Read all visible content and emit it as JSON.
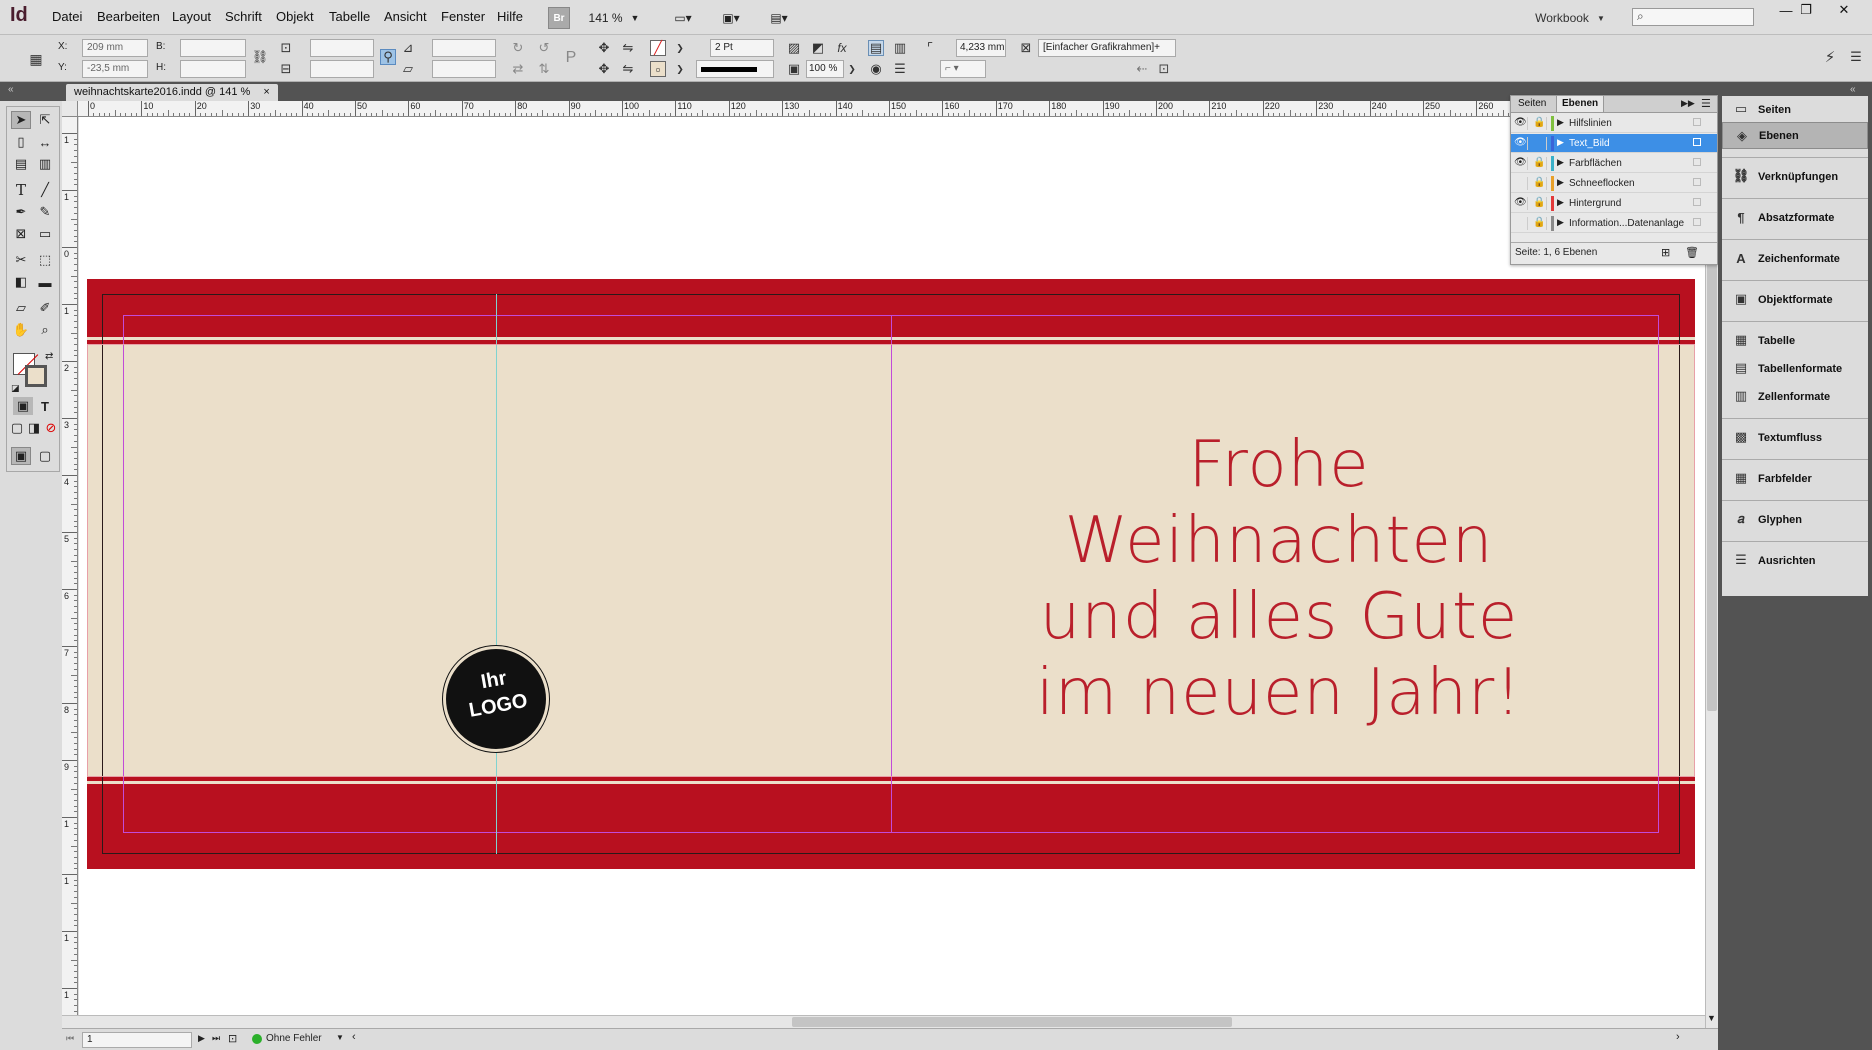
{
  "app": {
    "logo": "Id",
    "title": "InDesign"
  },
  "menu": [
    "Datei",
    "Bearbeiten",
    "Layout",
    "Schrift",
    "Objekt",
    "Tabelle",
    "Ansicht",
    "Fenster",
    "Hilfe"
  ],
  "menubar": {
    "bridge_label": "Br",
    "zoom": "141 %",
    "workspace": "Workbook",
    "search_placeholder": ""
  },
  "window_controls": {
    "minimize": "—",
    "restore": "❐",
    "close": "✕"
  },
  "control": {
    "x_label": "X:",
    "x_value": "209 mm",
    "y_label": "Y:",
    "y_value": "-23,5 mm",
    "w_label": "B:",
    "w_value": "",
    "h_label": "H:",
    "h_value": "",
    "stroke_weight": "2 Pt",
    "opacity": "100 %",
    "ref_value": "4,233 mm",
    "object_style": "[Einfacher Grafikrahmen]+"
  },
  "document_tab": {
    "label": "weihnachtskarte2016.indd @ 141 %",
    "close": "×"
  },
  "ruler_h": [
    "0",
    "10",
    "20",
    "30",
    "40",
    "50",
    "60",
    "70",
    "80",
    "90",
    "100",
    "110",
    "120",
    "130",
    "140",
    "150",
    "160",
    "170",
    "180",
    "190",
    "200",
    "210",
    "220",
    "230",
    "240",
    "250",
    "260"
  ],
  "ruler_v": [
    "1",
    "1",
    "0",
    "1",
    "2",
    "3",
    "4",
    "5",
    "6",
    "7",
    "8",
    "9",
    "1",
    "1",
    "1",
    "1"
  ],
  "card": {
    "greeting_line1": "Frohe Weihnachten",
    "greeting_line2": "und alles Gute",
    "greeting_line3": "im neuen Jahr!",
    "logo_line1": "Ihr",
    "logo_line2": "LOGO",
    "colors": {
      "red": "#b8101f",
      "beige": "#ebdfca",
      "text_red": "#b91f2b"
    }
  },
  "layers_panel": {
    "tab_pages": "Seiten",
    "tab_layers": "Ebenen",
    "layers": [
      {
        "name": "Hilfslinien",
        "color": "#7fbf3f",
        "visible": true,
        "locked": true,
        "selected": false
      },
      {
        "name": "Text_Bild",
        "color": "#3a64d8",
        "visible": true,
        "locked": false,
        "selected": true
      },
      {
        "name": "Farbflächen",
        "color": "#3ab0c8",
        "visible": true,
        "locked": true,
        "selected": false
      },
      {
        "name": "Schneeflocken",
        "color": "#e8a02a",
        "visible": false,
        "locked": true,
        "selected": false
      },
      {
        "name": "Hintergrund",
        "color": "#e23a3a",
        "visible": true,
        "locked": true,
        "selected": false
      },
      {
        "name": "Information...Datenanlage",
        "color": "#8a8a8a",
        "visible": false,
        "locked": true,
        "selected": false
      }
    ],
    "footer": "Seite: 1, 6 Ebenen"
  },
  "dock": [
    {
      "label": "Seiten",
      "icon": "pages-icon"
    },
    {
      "label": "Ebenen",
      "icon": "layers-icon",
      "active": true
    },
    {
      "label": "Verknüpfungen",
      "icon": "links-icon"
    },
    {
      "label": "Absatzformate",
      "icon": "paragraph-styles-icon"
    },
    {
      "label": "Zeichenformate",
      "icon": "character-styles-icon"
    },
    {
      "label": "Objektformate",
      "icon": "object-styles-icon"
    },
    {
      "label": "Tabelle",
      "icon": "table-icon"
    },
    {
      "label": "Tabellenformate",
      "icon": "table-styles-icon"
    },
    {
      "label": "Zellenformate",
      "icon": "cell-styles-icon"
    },
    {
      "label": "Textumfluss",
      "icon": "text-wrap-icon"
    },
    {
      "label": "Farbfelder",
      "icon": "swatches-icon"
    },
    {
      "label": "Glyphen",
      "icon": "glyphs-icon"
    },
    {
      "label": "Ausrichten",
      "icon": "align-icon"
    }
  ],
  "status": {
    "page": "1",
    "preflight": "Ohne Fehler"
  }
}
